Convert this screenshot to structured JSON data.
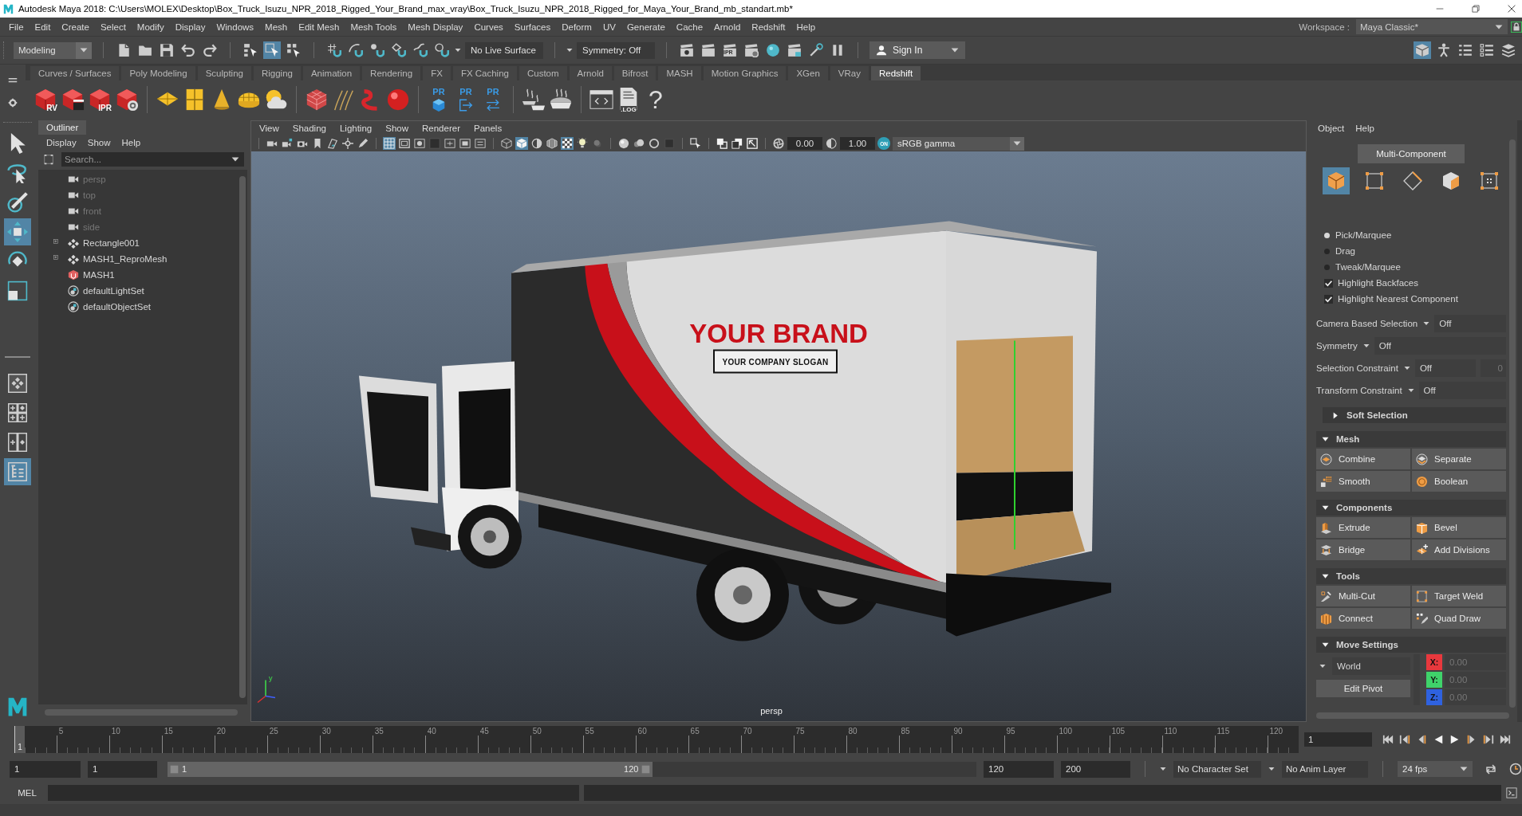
{
  "window": {
    "title": "Autodesk Maya 2018: C:\\Users\\MOLEX\\Desktop\\Box_Truck_Isuzu_NPR_2018_Rigged_Your_Brand_max_vray\\Box_Truck_Isuzu_NPR_2018_Rigged_for_Maya_Your_Brand_mb_standart.mb*"
  },
  "menu_bar": {
    "items": [
      "File",
      "Edit",
      "Create",
      "Select",
      "Modify",
      "Display",
      "Windows",
      "Mesh",
      "Edit Mesh",
      "Mesh Tools",
      "Mesh Display",
      "Curves",
      "Surfaces",
      "Deform",
      "UV",
      "Generate",
      "Cache",
      "Arnold",
      "Redshift",
      "Help"
    ],
    "workspace_label": "Workspace :",
    "workspace": "Maya Classic*"
  },
  "status_line": {
    "menu_set": "Modeling",
    "select_modes": [
      {
        "selected": false
      },
      {
        "selected": true
      },
      {
        "selected": false
      }
    ],
    "live_surface": "No Live Surface",
    "symmetry": "Symmetry: Off",
    "ipr_label": "IPR",
    "sign_in": "Sign In",
    "panel_toggles": [
      {
        "selected": true
      },
      {
        "selected": false
      },
      {
        "selected": false
      },
      {
        "selected": false
      },
      {
        "selected": false
      }
    ]
  },
  "shelf": {
    "tabs": [
      {
        "label": "Curves / Surfaces",
        "selected": false
      },
      {
        "label": "Poly Modeling",
        "selected": false
      },
      {
        "label": "Sculpting",
        "selected": false
      },
      {
        "label": "Rigging",
        "selected": false
      },
      {
        "label": "Animation",
        "selected": false
      },
      {
        "label": "Rendering",
        "selected": false
      },
      {
        "label": "FX",
        "selected": false
      },
      {
        "label": "FX Caching",
        "selected": false
      },
      {
        "label": "Custom",
        "selected": false
      },
      {
        "label": "Arnold",
        "selected": false
      },
      {
        "label": "Bifrost",
        "selected": false
      },
      {
        "label": "MASH",
        "selected": false
      },
      {
        "label": "Motion Graphics",
        "selected": false
      },
      {
        "label": "XGen",
        "selected": false
      },
      {
        "label": "VRay",
        "selected": false
      },
      {
        "label": "Redshift",
        "selected": true
      }
    ],
    "button_labels": [
      "RV",
      "IPR",
      "PR",
      "PR",
      "PR",
      ".LOG",
      "?"
    ]
  },
  "toolbox": {
    "tools": [
      {
        "selected": false
      },
      {
        "selected": false
      },
      {
        "selected": false
      },
      {
        "selected": true
      },
      {
        "selected": false
      },
      {
        "selected": false
      }
    ],
    "layouts": [
      {
        "selected": false
      },
      {
        "selected": false
      },
      {
        "selected": false
      },
      {
        "selected": true
      }
    ]
  },
  "outliner": {
    "title": "Outliner",
    "menu": [
      "Display",
      "Show",
      "Help"
    ],
    "search": {
      "placeholder": "Search..."
    },
    "items": [
      {
        "label": "persp",
        "kind": "camera",
        "dimmed": true,
        "expandable": false
      },
      {
        "label": "top",
        "kind": "camera",
        "dimmed": true,
        "expandable": false
      },
      {
        "label": "front",
        "kind": "camera",
        "dimmed": true,
        "expandable": false
      },
      {
        "label": "side",
        "kind": "camera",
        "dimmed": true,
        "expandable": false
      },
      {
        "label": "Rectangle001",
        "kind": "mesh",
        "dimmed": false,
        "expandable": true
      },
      {
        "label": "MASH1_ReproMesh",
        "kind": "mesh",
        "dimmed": false,
        "expandable": true
      },
      {
        "label": "MASH1",
        "kind": "mash",
        "dimmed": false,
        "expandable": false
      },
      {
        "label": "defaultLightSet",
        "kind": "set",
        "dimmed": false,
        "expandable": false
      },
      {
        "label": "defaultObjectSet",
        "kind": "set",
        "dimmed": false,
        "expandable": false
      }
    ]
  },
  "viewport": {
    "menu": [
      "View",
      "Shading",
      "Lighting",
      "Show",
      "Renderer",
      "Panels"
    ],
    "toggles": [
      {
        "selected": true
      },
      {
        "selected": false
      },
      {
        "selected": false
      },
      {
        "selected": false
      },
      {
        "selected": false
      },
      {
        "selected": false
      },
      {
        "selected": false
      },
      {
        "selected": false
      },
      {
        "selected": true
      },
      {
        "selected": false
      },
      {
        "selected": false
      },
      {
        "selected": true
      },
      {
        "selected": false
      },
      {
        "selected": false
      },
      {
        "selected": false
      },
      {
        "selected": false
      },
      {
        "selected": false
      },
      {
        "selected": false
      },
      {
        "selected": false
      },
      {
        "selected": false
      },
      {
        "selected": false
      }
    ],
    "exposure": "0.00",
    "gamma": "1.00",
    "color_management": {
      "label": "ON",
      "on": true
    },
    "view_transform": "sRGB gamma",
    "brand": "YOUR BRAND",
    "slogan": "YOUR COMPANY SLOGAN",
    "axis_label": "y",
    "camera": "persp"
  },
  "modeling_toolkit": {
    "menu": [
      "Object",
      "Help"
    ],
    "mode_button": "Multi-Component",
    "component_modes": [
      {
        "selected": true
      },
      {
        "selected": false
      },
      {
        "selected": false
      },
      {
        "selected": false
      },
      {
        "selected": false
      }
    ],
    "pick_modes": [
      {
        "label": "Pick/Marquee",
        "selected": true
      },
      {
        "label": "Drag",
        "selected": false
      },
      {
        "label": "Tweak/Marquee",
        "selected": false
      }
    ],
    "options": [
      {
        "label": "Highlight Backfaces",
        "checked": true
      },
      {
        "label": "Highlight Nearest Component",
        "checked": true
      }
    ],
    "settings": [
      {
        "label": "Camera Based Selection",
        "value": "Off"
      },
      {
        "label": "Symmetry",
        "value": "Off"
      },
      {
        "label": "Selection Constraint",
        "value": "Off",
        "value_2": {
          "value": "0",
          "disabled": true
        }
      },
      {
        "label": "Transform Constraint",
        "value": "Off"
      }
    ],
    "sections": [
      {
        "title": "Soft Selection",
        "expanded": false
      },
      {
        "title": "Mesh",
        "expanded": true,
        "buttons": [
          "Combine",
          "Separate",
          "Smooth",
          "Boolean"
        ]
      },
      {
        "title": "Components",
        "expanded": true,
        "buttons": [
          "Extrude",
          "Bevel",
          "Bridge",
          "Add Divisions"
        ]
      },
      {
        "title": "Tools",
        "expanded": true,
        "buttons": [
          "Multi-Cut",
          "Target Weld",
          "Connect",
          "Quad Draw"
        ]
      },
      {
        "title": "Move Settings",
        "expanded": true
      }
    ],
    "move_settings": {
      "space": "World",
      "axes": [
        {
          "label": "X:",
          "value": "0.00",
          "disabled": true,
          "color": "#e8383d"
        },
        {
          "label": "Y:",
          "value": "0.00",
          "disabled": true,
          "color": "#3fd36a"
        },
        {
          "label": "Z:",
          "value": "0.00",
          "disabled": true,
          "color": "#2f62e0"
        }
      ],
      "pivot_button": "Edit Pivot"
    }
  },
  "time_slider": {
    "ticks": [
      "5",
      "10",
      "15",
      "20",
      "25",
      "30",
      "35",
      "40",
      "45",
      "50",
      "55",
      "60",
      "65",
      "70",
      "75",
      "80",
      "85",
      "90",
      "95",
      "100",
      "105",
      "110",
      "115",
      "120"
    ],
    "current_frame": "1",
    "level": 0,
    "frame_field": "1"
  },
  "range_slider": {
    "animation_start": "1",
    "playback_start": "1",
    "range_start": "1",
    "range_end": "120",
    "level": 0.6,
    "playback_end": "120",
    "animation_end": "200",
    "character_set": "No Character Set",
    "anim_layer": "No Anim Layer",
    "fps": "24 fps"
  },
  "command_line": {
    "language": "MEL"
  }
}
